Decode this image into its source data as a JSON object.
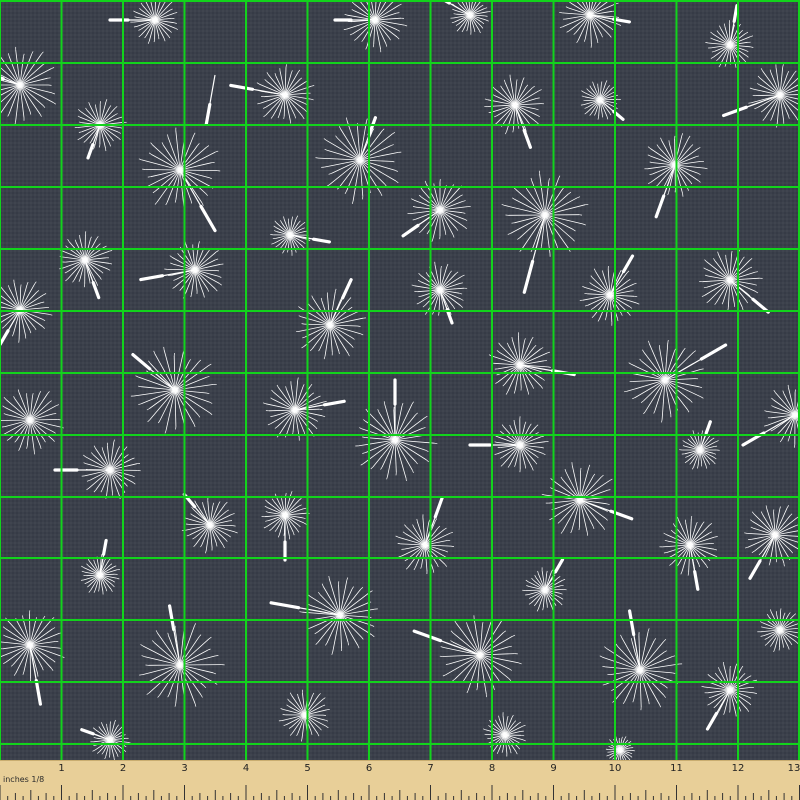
{
  "ruler": {
    "unit_label": "inches 1/8",
    "numbers": [
      "1",
      "2",
      "3",
      "4",
      "5",
      "6",
      "7",
      "8",
      "9",
      "10",
      "11",
      "12",
      "13"
    ]
  },
  "colors": {
    "background": "#3b404b",
    "grid": "#12d31c",
    "seed": "#ffffff",
    "ruler": "#e8cf98"
  },
  "pattern": "white dandelion seeds on dark slate fabric with green measurement grid"
}
